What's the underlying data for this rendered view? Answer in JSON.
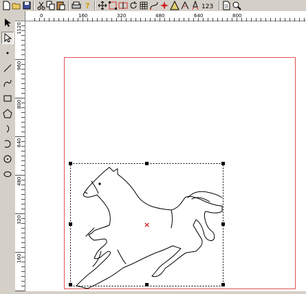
{
  "toolbar": {
    "buttons": [
      {
        "name": "new-file-icon"
      },
      {
        "name": "open-folder-icon"
      },
      {
        "name": "save-icon"
      },
      {
        "name": "cut-icon"
      },
      {
        "name": "copy-icon"
      },
      {
        "name": "paste-icon"
      },
      {
        "name": "print-icon"
      },
      {
        "name": "help-icon"
      },
      {
        "name": "move-icon"
      },
      {
        "name": "node-edit-icon"
      },
      {
        "name": "mirror-icon"
      },
      {
        "name": "rotate-icon"
      },
      {
        "name": "grid-icon"
      },
      {
        "name": "bezier-icon"
      },
      {
        "name": "red-point-icon"
      },
      {
        "name": "triangle-icon"
      },
      {
        "name": "measure-icon"
      },
      {
        "name": "rocket-icon"
      },
      {
        "name": "number-icon",
        "label": "123"
      },
      {
        "name": "page-icon"
      },
      {
        "name": "zoom-icon"
      }
    ]
  },
  "left_tools": [
    {
      "name": "select-arrow-icon"
    },
    {
      "name": "node-select-icon"
    },
    {
      "name": "point-icon"
    },
    {
      "name": "line-icon"
    },
    {
      "name": "curve-icon"
    },
    {
      "name": "rectangle-icon"
    },
    {
      "name": "polygon-icon"
    },
    {
      "name": "arc-icon"
    },
    {
      "name": "circle-arc-icon"
    },
    {
      "name": "spiral-icon"
    },
    {
      "name": "ellipse-icon"
    }
  ],
  "rulers": {
    "horizontal_labels": [
      "0",
      "160",
      "320",
      "480",
      "640",
      "800"
    ],
    "vertical_labels": [
      "1120",
      "960",
      "800",
      "640",
      "480",
      "320",
      "160",
      "0"
    ]
  },
  "canvas": {
    "page_border_color": "#e05050",
    "center_mark_color": "#d02020",
    "center_mark": "×"
  }
}
